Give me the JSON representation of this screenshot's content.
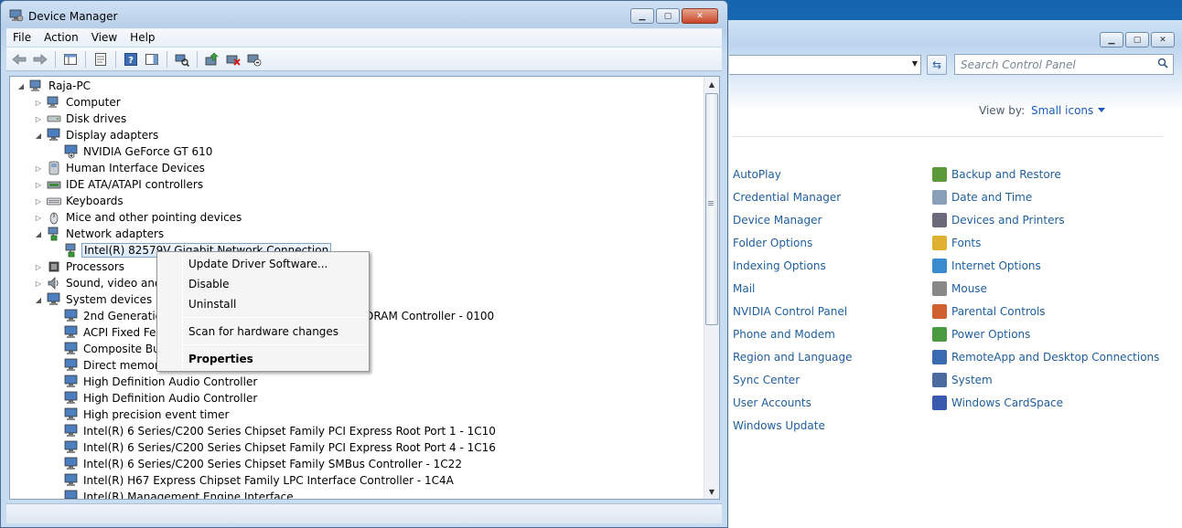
{
  "control_panel": {
    "search_placeholder": "Search Control Panel",
    "view_by_label": "View by:",
    "view_by_value": "Small icons",
    "column1": [
      "AutoPlay",
      "Credential Manager",
      "Device Manager",
      "Folder Options",
      "Indexing Options",
      "Mail",
      "NVIDIA Control Panel",
      "Phone and Modem",
      "Region and Language",
      "Sync Center",
      "User Accounts",
      "Windows Update"
    ],
    "column2": [
      "Backup and Restore",
      "Date and Time",
      "Devices and Printers",
      "Fonts",
      "Internet Options",
      "Mouse",
      "Parental Controls",
      "Power Options",
      "RemoteApp and Desktop Connections",
      "System",
      "Windows CardSpace"
    ],
    "column1_icon_colors": [
      "#3a8a3a",
      "#d9a640",
      "#6b7b8c",
      "#e2b94a",
      "#7a8a9a",
      "#4a78b8",
      "#76b900",
      "#8a8a8a",
      "#3b7fc4",
      "#3aa04a",
      "#4a90d0",
      "#3a7ad0"
    ],
    "column2_icon_colors": [
      "#5a9a3a",
      "#8aa0b8",
      "#6a6a7a",
      "#e0b030",
      "#3a8ad0",
      "#888888",
      "#d06030",
      "#4a9a40",
      "#3a6ab0",
      "#4a6aa0",
      "#3a5ab0"
    ]
  },
  "device_manager": {
    "title": "Device Manager",
    "menu": [
      "File",
      "Action",
      "View",
      "Help"
    ],
    "tree": [
      {
        "label": "Raja-PC",
        "level": 0,
        "expander": "open",
        "icon": "computer-icon"
      },
      {
        "label": "Computer",
        "level": 1,
        "expander": "closed",
        "icon": "computer-icon"
      },
      {
        "label": "Disk drives",
        "level": 1,
        "expander": "closed",
        "icon": "disk-icon"
      },
      {
        "label": "Display adapters",
        "level": 1,
        "expander": "open",
        "icon": "display-icon"
      },
      {
        "label": "NVIDIA GeForce GT 610",
        "level": 2,
        "expander": "none",
        "icon": "display-warning-icon"
      },
      {
        "label": "Human Interface Devices",
        "level": 1,
        "expander": "closed",
        "icon": "hid-icon"
      },
      {
        "label": "IDE ATA/ATAPI controllers",
        "level": 1,
        "expander": "closed",
        "icon": "ide-icon"
      },
      {
        "label": "Keyboards",
        "level": 1,
        "expander": "closed",
        "icon": "keyboard-icon"
      },
      {
        "label": "Mice and other pointing devices",
        "level": 1,
        "expander": "closed",
        "icon": "mouse-icon"
      },
      {
        "label": "Network adapters",
        "level": 1,
        "expander": "open",
        "icon": "network-icon"
      },
      {
        "label": "Intel(R) 82579V Gigabit Network Connection",
        "level": 2,
        "expander": "none",
        "icon": "network-icon",
        "selected": true
      },
      {
        "label": "Processors",
        "level": 1,
        "expander": "closed",
        "icon": "processor-icon"
      },
      {
        "label": "Sound, video and game controllers",
        "level": 1,
        "expander": "closed",
        "icon": "sound-icon"
      },
      {
        "label": "System devices",
        "level": 1,
        "expander": "open",
        "icon": "system-icon"
      },
      {
        "label": "2nd Generation Intel(R) Core(TM) Processor Family DRAM Controller - 0100",
        "level": 2,
        "expander": "none",
        "icon": "system-icon"
      },
      {
        "label": "ACPI Fixed Feature Button",
        "level": 2,
        "expander": "none",
        "icon": "system-icon"
      },
      {
        "label": "Composite Bus Enumerator",
        "level": 2,
        "expander": "none",
        "icon": "system-icon"
      },
      {
        "label": "Direct memory access controller",
        "level": 2,
        "expander": "none",
        "icon": "system-icon"
      },
      {
        "label": "High Definition Audio Controller",
        "level": 2,
        "expander": "none",
        "icon": "system-icon"
      },
      {
        "label": "High Definition Audio Controller",
        "level": 2,
        "expander": "none",
        "icon": "system-icon"
      },
      {
        "label": "High precision event timer",
        "level": 2,
        "expander": "none",
        "icon": "system-icon"
      },
      {
        "label": "Intel(R) 6 Series/C200 Series Chipset Family PCI Express Root Port 1 - 1C10",
        "level": 2,
        "expander": "none",
        "icon": "system-icon"
      },
      {
        "label": "Intel(R) 6 Series/C200 Series Chipset Family PCI Express Root Port 4 - 1C16",
        "level": 2,
        "expander": "none",
        "icon": "system-icon"
      },
      {
        "label": "Intel(R) 6 Series/C200 Series Chipset Family SMBus Controller - 1C22",
        "level": 2,
        "expander": "none",
        "icon": "system-icon"
      },
      {
        "label": "Intel(R) H67 Express Chipset Family LPC Interface Controller - 1C4A",
        "level": 2,
        "expander": "none",
        "icon": "system-icon"
      },
      {
        "label": "Intel(R) Management Engine Interface",
        "level": 2,
        "expander": "none",
        "icon": "system-icon"
      }
    ],
    "context_menu": {
      "items": [
        "Update Driver Software...",
        "Disable",
        "Uninstall",
        "Scan for hardware changes",
        "Properties"
      ]
    }
  }
}
